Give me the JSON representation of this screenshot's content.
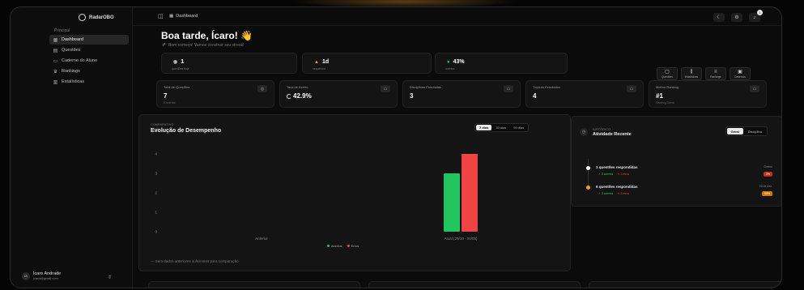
{
  "app": {
    "brand": "RadarOBO"
  },
  "sidebar": {
    "section": "Principal",
    "items": [
      {
        "label": "Dashboard",
        "icon": "grid-icon",
        "glyph": "▦",
        "active": true
      },
      {
        "label": "Questões",
        "icon": "file-icon",
        "glyph": "▤",
        "active": false
      },
      {
        "label": "Caderno do Aluno",
        "icon": "notebook-icon",
        "glyph": "▭",
        "active": false
      },
      {
        "label": "Rankings",
        "icon": "trophy-icon",
        "glyph": "♛",
        "active": false
      },
      {
        "label": "Estatísticas",
        "icon": "bar-chart-icon",
        "glyph": "▥",
        "active": false
      }
    ],
    "user": {
      "initials": "IA",
      "name": "Icaro Andrade",
      "email": "icaro@gmail.com"
    }
  },
  "topbar": {
    "breadcrumb": "Dashboard",
    "badge": "1"
  },
  "greeting": {
    "title": "Boa tarde, Ícaro! 👋",
    "subtitle": "Bom começo! Vamos construir seu streak!"
  },
  "mini_stats": [
    {
      "value": "1",
      "label": "questões hoje",
      "icon": "target-icon",
      "glyph": "◉",
      "color": "#bbbbbb"
    },
    {
      "value": "1d",
      "label": "sequência",
      "icon": "flame-icon",
      "glyph": "▲",
      "color": "#e0a030"
    },
    {
      "value": "43%",
      "label": "acertos",
      "icon": "check-icon",
      "glyph": "●",
      "color": "#27c25a"
    }
  ],
  "quick_actions": [
    {
      "label": "Questões",
      "glyph": "▢",
      "icon": "questions-icon"
    },
    {
      "label": "Estatísticas",
      "glyph": "⫼",
      "icon": "stats-icon"
    },
    {
      "label": "Rankings",
      "glyph": "♕",
      "icon": "ranking-icon"
    },
    {
      "label": "Cadernos",
      "glyph": "▣",
      "icon": "notebooks-icon"
    }
  ],
  "stats": [
    {
      "label": "Total de Questões",
      "value": "7",
      "sub": "8 acertos",
      "glyph": "◎"
    },
    {
      "label": "Taxa de Acerto",
      "value": "42.9%",
      "sub": "",
      "glyph": "▭"
    },
    {
      "label": "Disciplinas Estudadas",
      "value": "3",
      "sub": "",
      "glyph": "▭"
    },
    {
      "label": "Tópicos Estudados",
      "value": "4",
      "sub": "",
      "glyph": "▭"
    },
    {
      "label": "Melhor Ranking",
      "value": "#1",
      "sub": "Ranking Geral",
      "glyph": "▭"
    }
  ],
  "performance": {
    "overline": "COMPARATIVO",
    "title": "Evolução de Desempenho",
    "ranges": [
      "7 dias",
      "30 dias",
      "90 dias"
    ],
    "active_range": 0,
    "note": "Sem dados anteriores suficientes para comparação"
  },
  "chart_data": {
    "type": "bar",
    "categories": [
      "Anterior",
      "Atual (29/10 - 04/05)"
    ],
    "series": [
      {
        "name": "Acertos",
        "values": [
          0,
          3
        ],
        "color": "#22c55e"
      },
      {
        "name": "Erros",
        "values": [
          0,
          4
        ],
        "color": "#ef4444"
      }
    ],
    "yticks": [
      0,
      1,
      2,
      3,
      4
    ],
    "ylim": [
      0,
      4
    ],
    "grid": true,
    "legend": "bottom"
  },
  "activity": {
    "overline": "HISTÓRICO",
    "title": "Atividade Recente",
    "toggle": [
      "Geral",
      "Disciplina"
    ],
    "active_toggle": 0,
    "items": [
      {
        "title": "1 questões respondidas",
        "correct": "0 acertos",
        "wrong": "1 erros",
        "date": "Ontem",
        "pct": "0%",
        "dot": "#ffffff",
        "pct_color": "#c0301f"
      },
      {
        "title": "6 questões respondidas",
        "correct": "3 acertos",
        "wrong": "3 erros",
        "date": "29 de dez.",
        "pct": "50%",
        "dot": "#f59e0b",
        "pct_color": "#d97706"
      }
    ]
  }
}
